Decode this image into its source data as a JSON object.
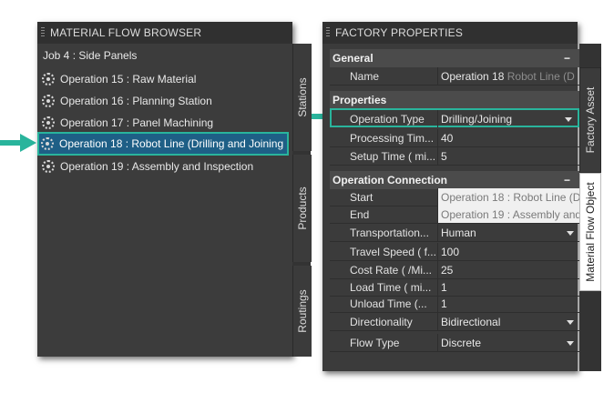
{
  "browser": {
    "title": "MATERIAL FLOW BROWSER",
    "job": "Job 4 : Side Panels",
    "operations": [
      "Operation 15 : Raw Material",
      "Operation 16 : Planning Station",
      "Operation 17 : Panel Machining",
      "Operation 18 : Robot Line (Drilling and Joining",
      "Operation 19 : Assembly and Inspection"
    ],
    "tabs": [
      "Stations",
      "Products",
      "Routings"
    ]
  },
  "properties": {
    "title": "FACTORY PROPERTIES",
    "general": {
      "header": "General",
      "name_label": "Name",
      "name_value": "Operation 18",
      "name_value_dim": "Robot Line (D"
    },
    "props": {
      "header": "Properties",
      "op_type_label": "Operation Type",
      "op_type_value": "Drilling/Joining",
      "proc_time_label": "Processing Tim...",
      "proc_time_value": "40",
      "setup_time_label": "Setup Time ( mi...",
      "setup_time_value": "5"
    },
    "connection": {
      "header": "Operation Connection",
      "start_label": "Start",
      "start_value": "Operation 18 : Robot Line (D",
      "end_label": "End",
      "end_value": "Operation 19 : Assembly and",
      "transport_label": "Transportation...",
      "transport_value": "Human",
      "speed_label": "Travel Speed ( f...",
      "speed_value": "100",
      "cost_label": "Cost Rate ( /Mi...",
      "cost_value": "25",
      "load_label": "Load Time ( mi...",
      "load_value": "1",
      "unload_label": "Unload Time (...",
      "unload_value": "1",
      "direction_label": "Directionality",
      "direction_value": "Bidirectional",
      "flow_label": "Flow Type",
      "flow_value": "Discrete"
    },
    "collapse_glyph": "−",
    "tabs": [
      "Factory Asset",
      "Material Flow Object"
    ]
  },
  "colors": {
    "accent": "#29b49c",
    "selection": "#1e5f86",
    "panel": "#3b3b3b"
  },
  "icons": [
    "gear-icon",
    "grip-icon",
    "chevron-down-icon",
    "arrow-right-icon"
  ]
}
